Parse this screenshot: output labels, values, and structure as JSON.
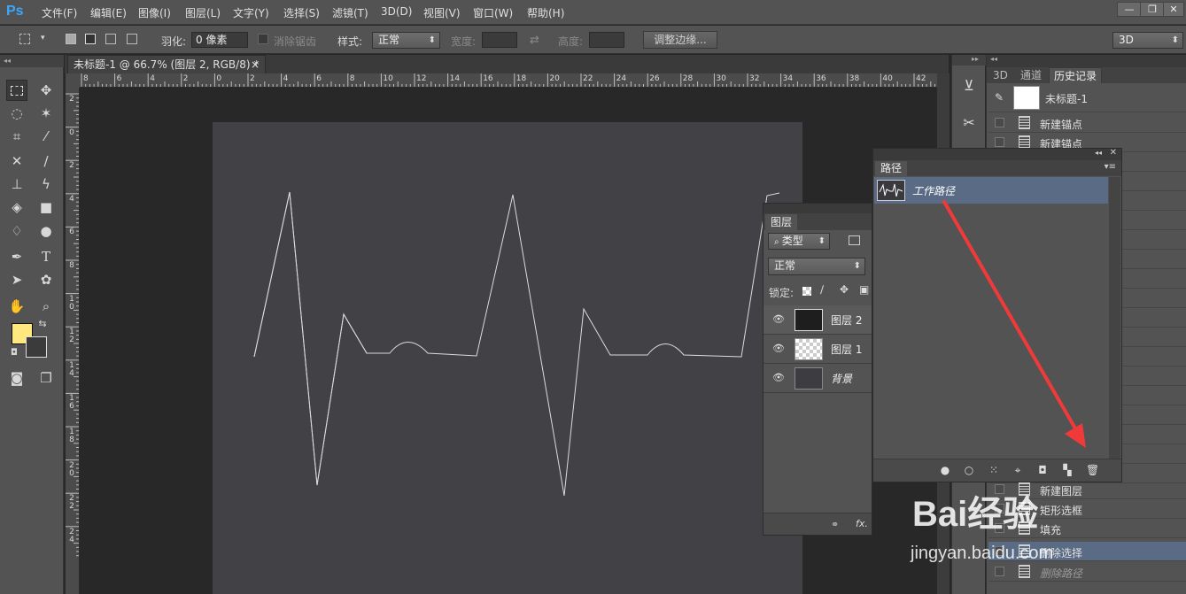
{
  "app": {
    "logo": "Ps",
    "menu": [
      "文件(F)",
      "编辑(E)",
      "图像(I)",
      "图层(L)",
      "文字(Y)",
      "选择(S)",
      "滤镜(T)",
      "3D(D)",
      "视图(V)",
      "窗口(W)",
      "帮助(H)"
    ],
    "window_buttons": [
      "—",
      "❐",
      "✕"
    ]
  },
  "options": {
    "feather_label": "羽化:",
    "feather_value": "0 像素",
    "antialias_label": "消除锯齿",
    "style_label": "样式:",
    "style_value": "正常",
    "width_label": "宽度:",
    "height_label": "高度:",
    "refine_button": "调整边缘...",
    "workspace": "3D"
  },
  "document": {
    "tab_title": "未标题-1 @ 66.7% (图层 2, RGB/8) *",
    "tab_close": "×",
    "ruler_h": [
      "8",
      "6",
      "4",
      "2",
      "0",
      "2",
      "4",
      "6",
      "8",
      "10",
      "12",
      "14",
      "16",
      "18",
      "20",
      "22",
      "24",
      "26",
      "28",
      "30",
      "32",
      "34",
      "36",
      "38",
      "40",
      "42"
    ],
    "ruler_v": [
      "2",
      "0",
      "2",
      "4",
      "6",
      "8",
      "10",
      "12",
      "14",
      "16",
      "18",
      "20",
      "22",
      "24"
    ],
    "canvas_color": "#414146"
  },
  "toolbox": {
    "collapse": "◂◂",
    "tools": [
      "rect-marquee",
      "move",
      "lasso",
      "magic-wand",
      "crop",
      "eyedropper",
      "healing",
      "brush",
      "clone-stamp",
      "history-brush",
      "eraser",
      "gradient",
      "blur",
      "dodge",
      "pen",
      "type",
      "path-select",
      "shape",
      "hand",
      "zoom"
    ],
    "type_tool_glyph": "T",
    "foreground_color": "#ffe97f",
    "background_color": "#3b3b3b"
  },
  "history": {
    "tabs": [
      "3D",
      "通道",
      "历史记录"
    ],
    "snapshot_label": "未标题-1",
    "items": [
      "新建锚点",
      "新建锚点",
      "新建图层",
      "矩形选框",
      "填充",
      "删除选择",
      "删除路径"
    ]
  },
  "layers": {
    "tab": "图层",
    "filter": "类型",
    "blend_mode": "正常",
    "lock_label": "锁定:",
    "rows": [
      "图层 2",
      "图层 1",
      "背景"
    ],
    "footer_icons": [
      "link",
      "fx",
      "mask"
    ],
    "footer_fx": "fx."
  },
  "paths": {
    "tab": "路径",
    "row_name": "工作路径"
  },
  "watermark": {
    "text": "Bai经验",
    "url": "jingyan.baidu.com"
  }
}
